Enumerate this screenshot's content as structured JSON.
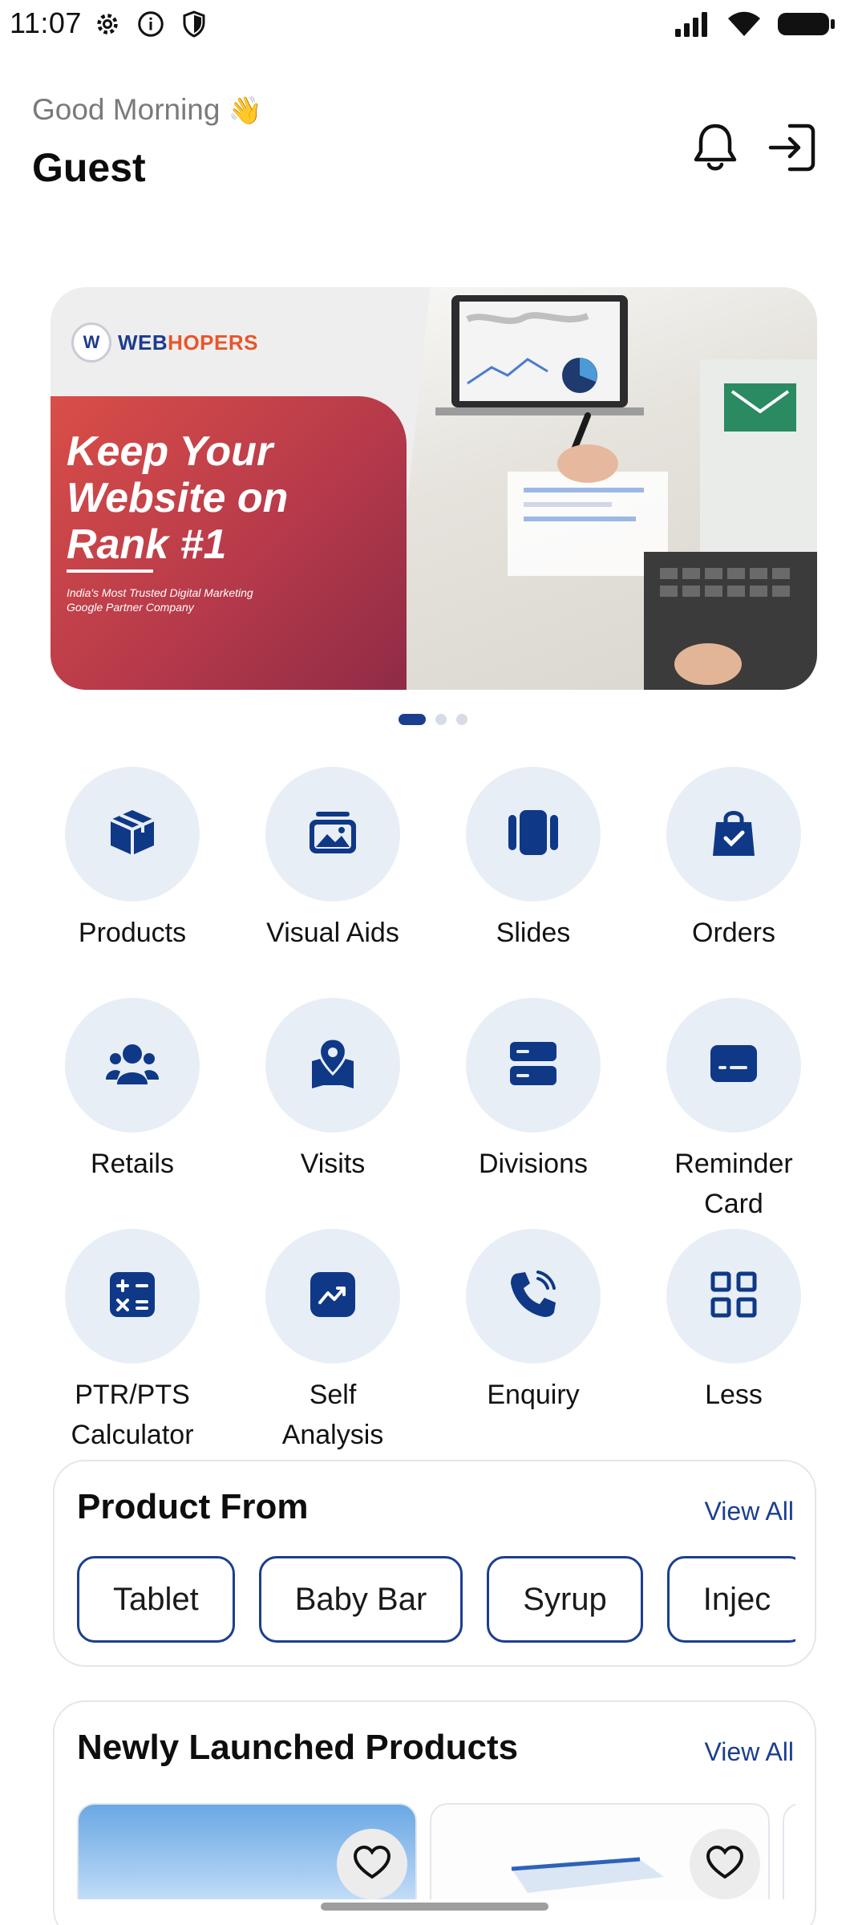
{
  "status_bar": {
    "time": "11:07"
  },
  "header": {
    "greeting": "Good Morning",
    "greeting_emoji": "👋",
    "user_name": "Guest"
  },
  "banner": {
    "brand_w": "WEB",
    "brand_h": "HOPERS",
    "logo_mark": "W",
    "headline_1": "Keep Your",
    "headline_2": "Website on",
    "headline_3": "Rank #1",
    "subline_1": "India's Most Trusted Digital Marketing",
    "subline_2": "Google Partner Company"
  },
  "carousel": {
    "count": 3,
    "active_index": 0
  },
  "menu": [
    {
      "label": "Products",
      "icon": "box-icon"
    },
    {
      "label": "Visual Aids",
      "icon": "image-icon"
    },
    {
      "label": "Slides",
      "icon": "slides-icon"
    },
    {
      "label": "Orders",
      "icon": "bag-check-icon"
    },
    {
      "label": "Retails",
      "icon": "people-icon"
    },
    {
      "label": "Visits",
      "icon": "map-pin-icon"
    },
    {
      "label": "Divisions",
      "icon": "server-icon"
    },
    {
      "label": "Reminder Card",
      "icon": "card-icon"
    },
    {
      "label": "PTR/PTS Calculator",
      "icon": "calculator-icon"
    },
    {
      "label": "Self Analysis",
      "icon": "trend-icon"
    },
    {
      "label": "Enquiry",
      "icon": "phone-icon"
    },
    {
      "label": "Less",
      "icon": "grid-icon"
    }
  ],
  "product_from": {
    "title": "Product From",
    "view_all": "View All",
    "chips": [
      "Tablet",
      "Baby Bar",
      "Syrup",
      "Injec"
    ]
  },
  "newly_launched": {
    "title": "Newly Launched Products",
    "view_all": "View All"
  },
  "colors": {
    "accent": "#1b3f8f",
    "tile_bg": "#e8eef6",
    "banner_red": "#c8444a"
  }
}
